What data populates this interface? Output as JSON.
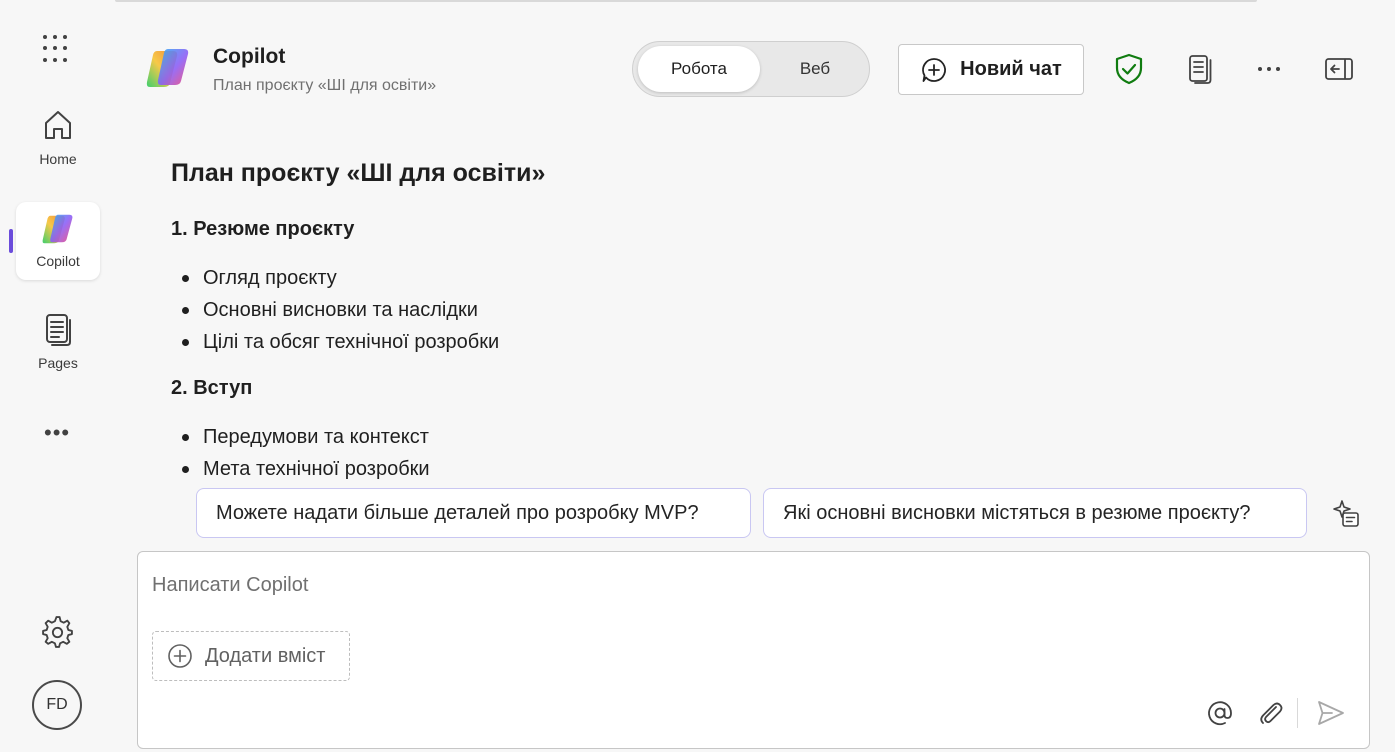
{
  "rail": {
    "items": [
      {
        "label": "Home"
      },
      {
        "label": "Copilot"
      },
      {
        "label": "Pages"
      }
    ],
    "avatar_initials": "FD"
  },
  "header": {
    "title": "Copilot",
    "subtitle": "План проєкту «ШІ для освіти»",
    "toggle": {
      "active": "Робота",
      "inactive": "Веб"
    },
    "new_chat_label": "Новий чат",
    "icons": [
      "shield-check-icon",
      "notebook-icon",
      "more-icon",
      "collapse-panel-icon"
    ]
  },
  "document": {
    "title": "План проєкту «ШІ для освіти»",
    "sections": [
      {
        "heading": "1. Резюме проєкту",
        "bullets": [
          "Огляд проєкту",
          "Основні висновки та наслідки",
          "Цілі та обсяг технічної розробки"
        ]
      },
      {
        "heading": "2. Вступ",
        "bullets": [
          "Передумови та контекст",
          "Мета технічної розробки"
        ]
      }
    ]
  },
  "suggestions": [
    "Можете надати більше деталей про розробку MVP?",
    "Які основні висновки містяться в резюме проєкту?"
  ],
  "composer": {
    "placeholder": "Написати Copilot",
    "add_content_label": "Додати вміст"
  },
  "colors": {
    "accent": "#6b4cdb",
    "shield": "#107c10",
    "suggestion_border": "#c9c7f2"
  }
}
